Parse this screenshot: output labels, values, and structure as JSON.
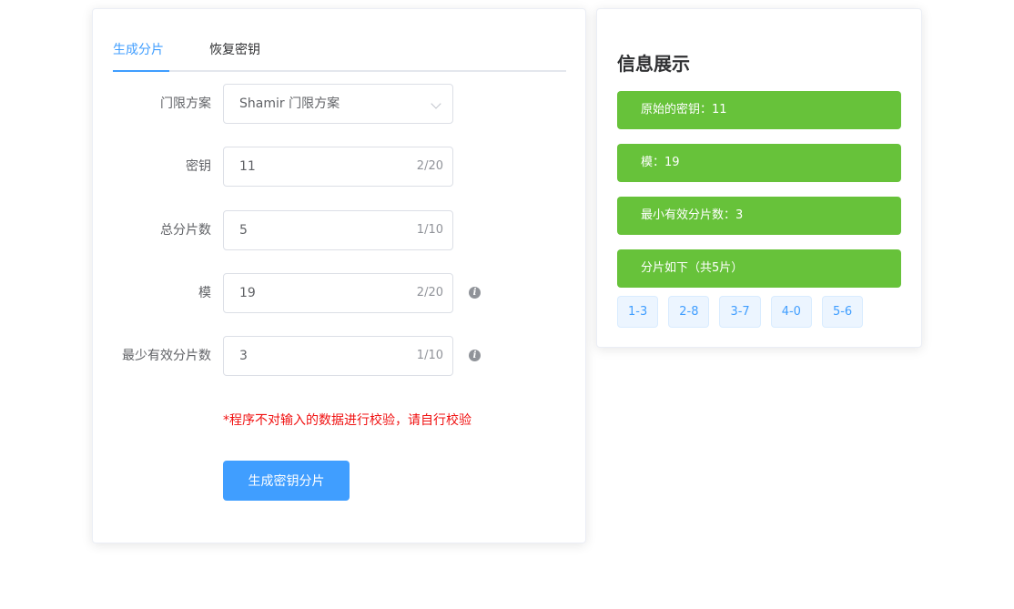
{
  "tabs": {
    "generate": "生成分片",
    "recover": "恢复密钥"
  },
  "form": {
    "scheme": {
      "label": "门限方案",
      "value": "Shamir 门限方案"
    },
    "secret": {
      "label": "密钥",
      "value": "11",
      "count": "2/20"
    },
    "total_shares": {
      "label": "总分片数",
      "value": "5",
      "count": "1/10"
    },
    "modulus": {
      "label": "模",
      "value": "19",
      "count": "2/20"
    },
    "min_shares": {
      "label": "最少有效分片数",
      "value": "3",
      "count": "1/10"
    },
    "warning": "*程序不对输入的数据进行校验，请自行校验",
    "submit_label": "生成密钥分片"
  },
  "info": {
    "title": "信息展示",
    "alerts": [
      "原始的密钥：11",
      "模：19",
      "最小有效分片数：3",
      "分片如下（共5片）"
    ],
    "shares": [
      "1-3",
      "2-8",
      "3-7",
      "4-0",
      "5-6"
    ]
  },
  "colors": {
    "primary": "#409eff",
    "success": "#67c23a",
    "danger": "#f01010",
    "tag_bg": "#ecf5ff"
  },
  "icons": {
    "info": "info-circle-icon",
    "select": "chevron-down-icon"
  }
}
